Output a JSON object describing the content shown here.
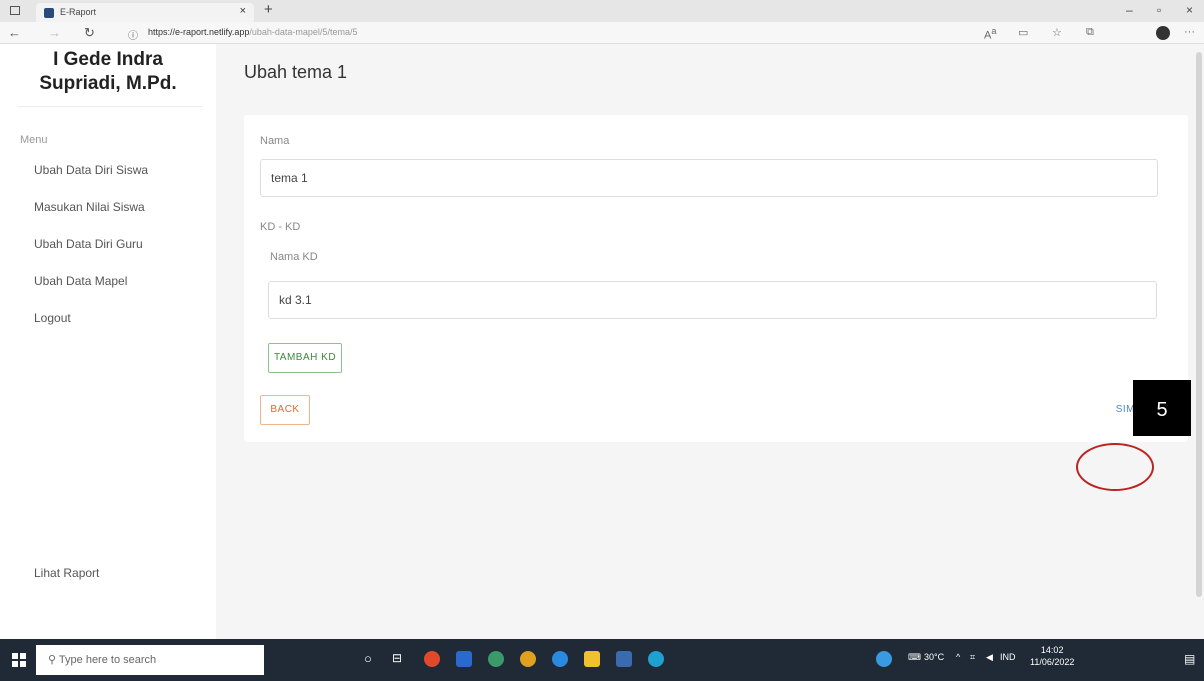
{
  "browser": {
    "tab_title": "E-Raport",
    "tab_close": "×",
    "new_tab": "+",
    "url_host": "https://e-raport.netlify.app",
    "url_path": "/ubah-data-mapel/5/tema/5",
    "win_min": "–",
    "win_max": "▫",
    "win_close": "×"
  },
  "sidebar": {
    "user_line1": "I Gede Indra",
    "user_line2": "Supriadi, M.Pd.",
    "menu_title": "Menu",
    "items": [
      {
        "label": "Ubah Data Diri Siswa"
      },
      {
        "label": "Masukan Nilai Siswa"
      },
      {
        "label": "Ubah Data Diri Guru"
      },
      {
        "label": "Ubah Data Mapel"
      },
      {
        "label": "Logout"
      }
    ],
    "bottom_link": "Lihat Raport"
  },
  "main": {
    "page_title": "Ubah tema 1",
    "nama_label": "Nama",
    "nama_value": "tema 1",
    "kd_section_label": "KD - KD",
    "nama_kd_label": "Nama KD",
    "nama_kd_value": "kd 3.1",
    "tambah_kd_label": "TAMBAH KD",
    "back_label": "BACK",
    "simpan_label": "SIMPAN"
  },
  "annotation": {
    "step_number": "5",
    "circle_color": "#bb2222"
  },
  "taskbar": {
    "search_placeholder": "Type here to search",
    "temperature": "30°C",
    "language": "IND",
    "time": "14:02",
    "date": "11/06/2022"
  },
  "colors": {
    "tambah": "#3b8a3b",
    "back": "#e06a2a",
    "simpan": "#4a8ac9"
  }
}
